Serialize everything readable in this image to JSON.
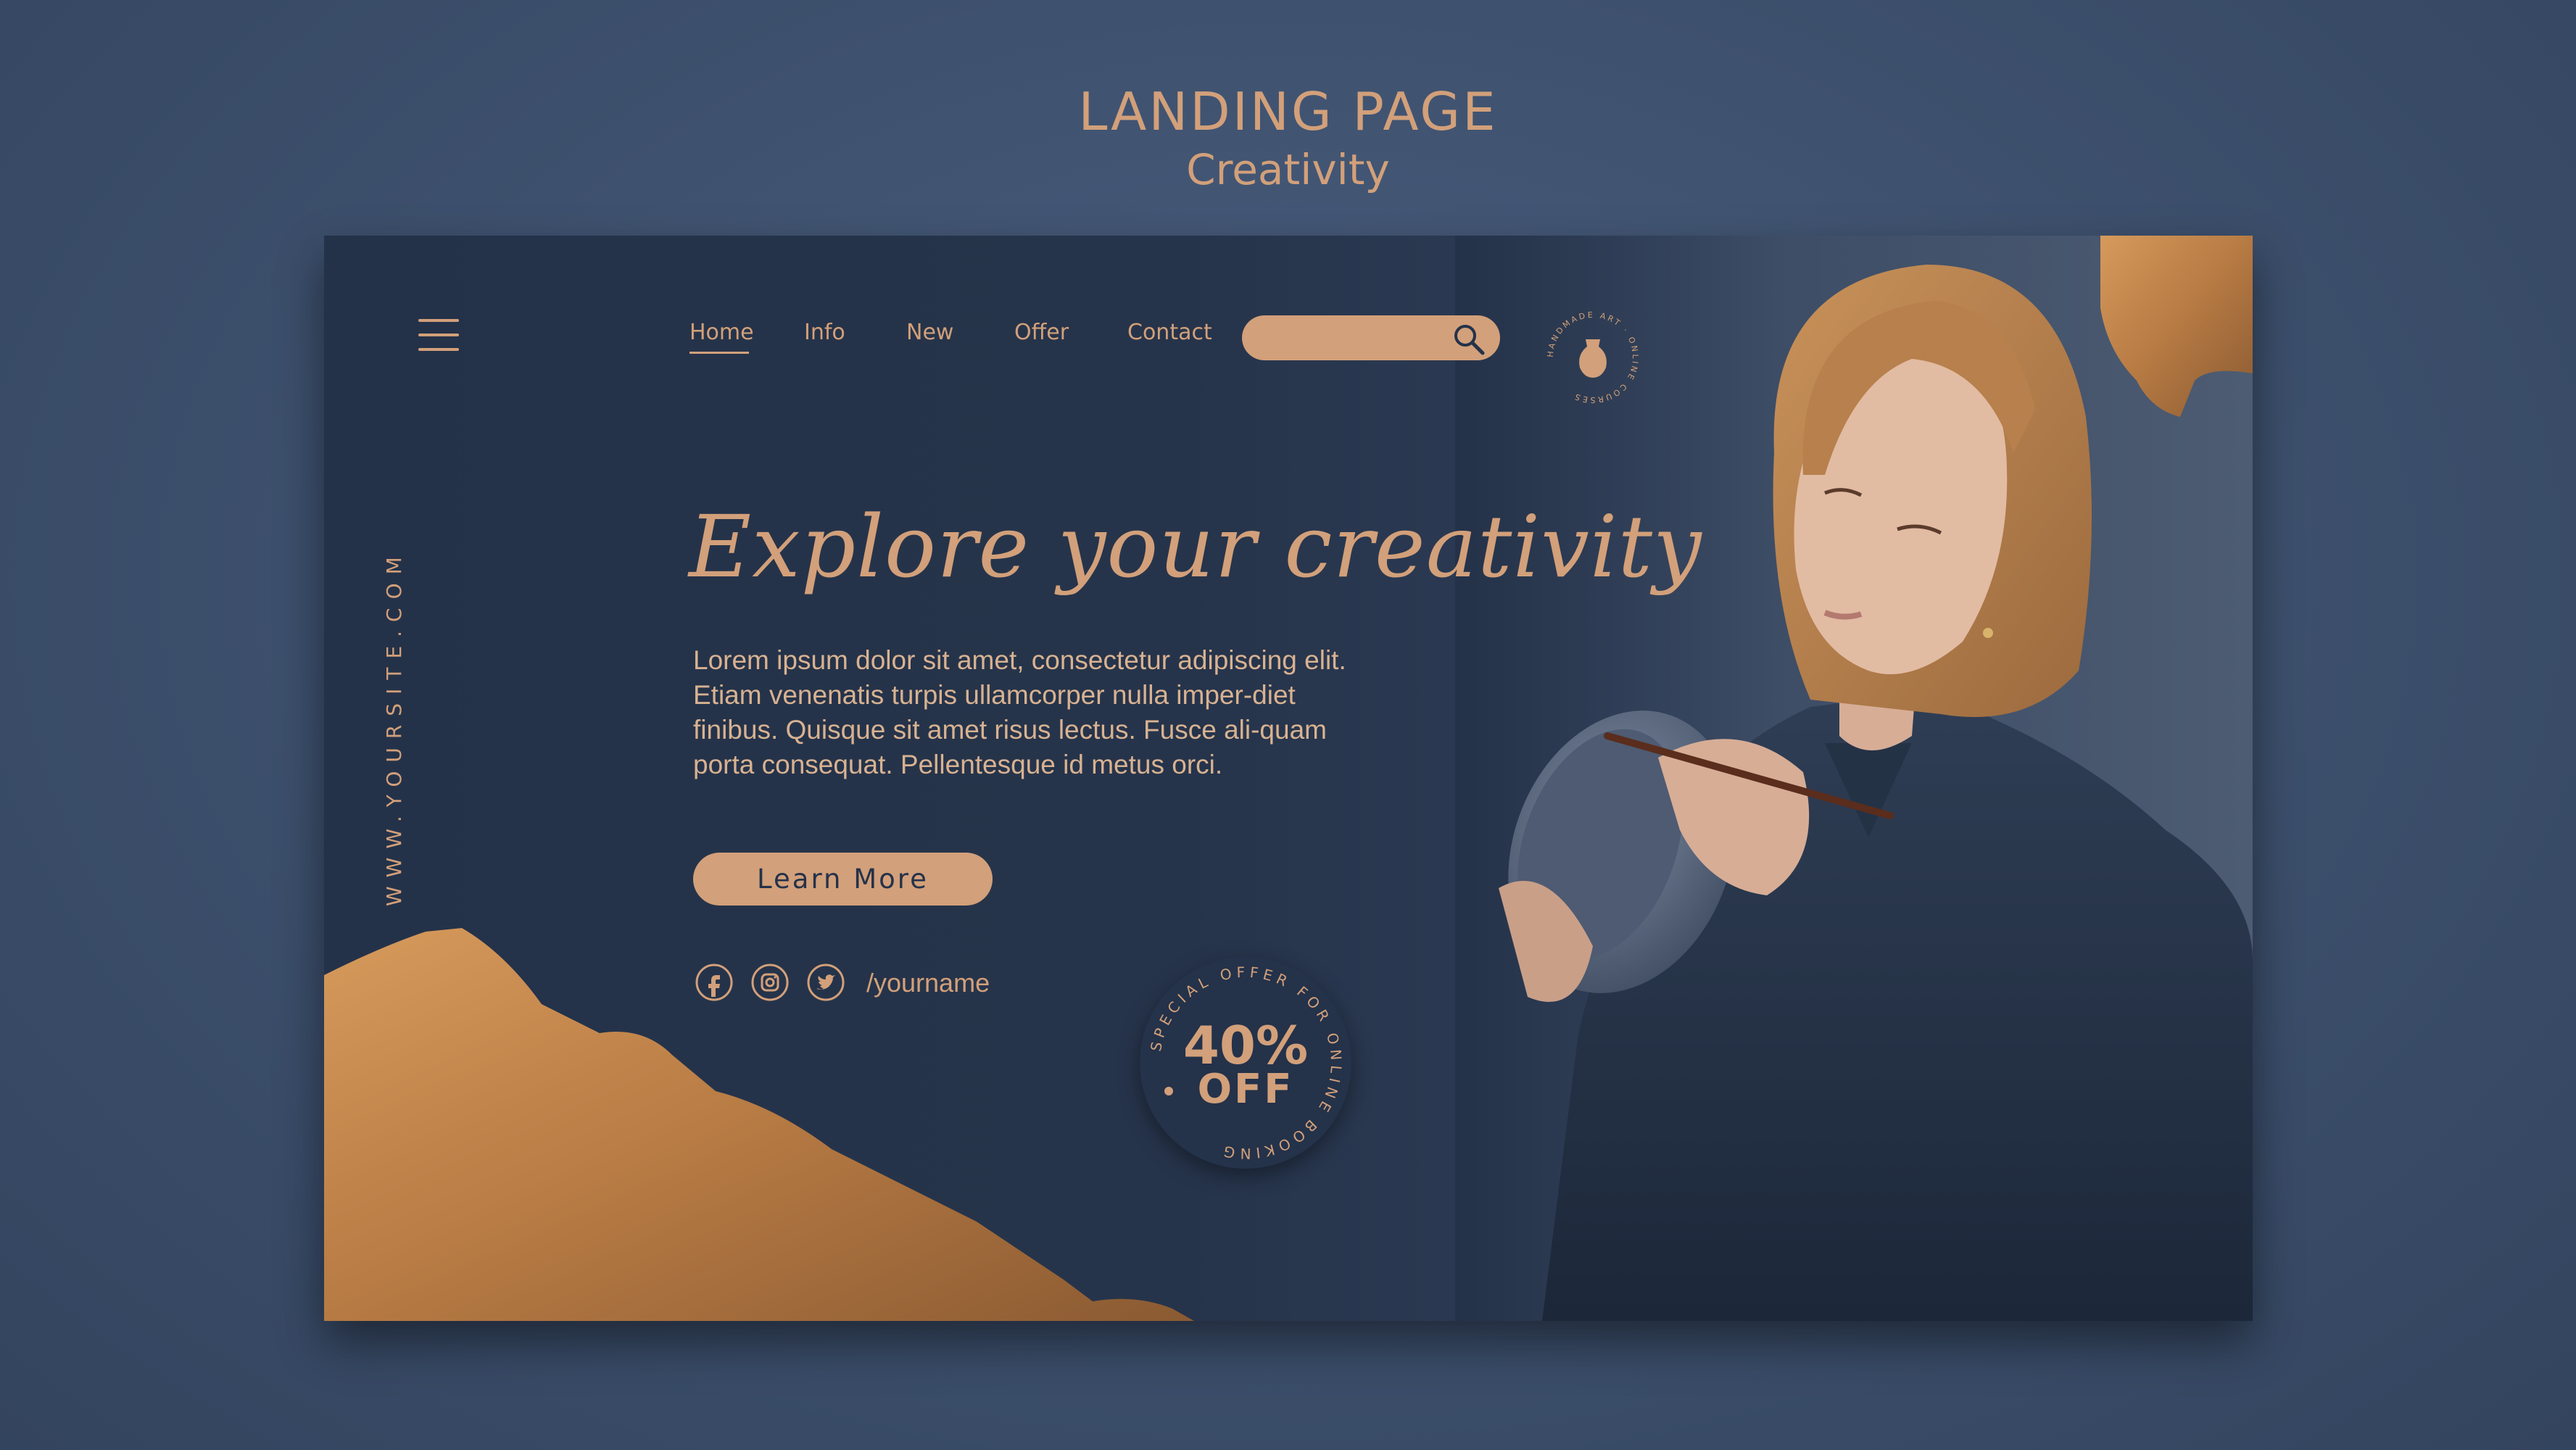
{
  "header": {
    "title": "LANDING PAGE",
    "subtitle": "Creativity"
  },
  "nav": {
    "items": [
      "Home",
      "Info",
      "New",
      "Offer",
      "Contact"
    ],
    "active": "Home"
  },
  "search": {
    "placeholder": ""
  },
  "logo": {
    "ring_text": "HANDMADE ART · ONLINE COURSES"
  },
  "side_url": "WWW.YOURSITE.COM",
  "hero": {
    "title": "Explore your creativity",
    "body": "Lorem ipsum dolor sit amet, consectetur adipiscing elit. Etiam venenatis turpis ullamcorper nulla imper-diet finibus. Quisque sit amet risus lectus. Fusce ali-quam porta consequat. Pellentesque id metus orci.",
    "cta_label": "Learn More"
  },
  "social": {
    "icons": [
      "facebook-icon",
      "instagram-icon",
      "twitter-icon"
    ],
    "handle": "/yourname"
  },
  "offer": {
    "ring_text": "SPECIAL OFFER FOR ONLINE BOOKING",
    "percent": "40%",
    "off": "OFF"
  },
  "colors": {
    "accent": "#d2a07a",
    "card_bg": "#26344b",
    "page_bg": "#3f5270"
  }
}
